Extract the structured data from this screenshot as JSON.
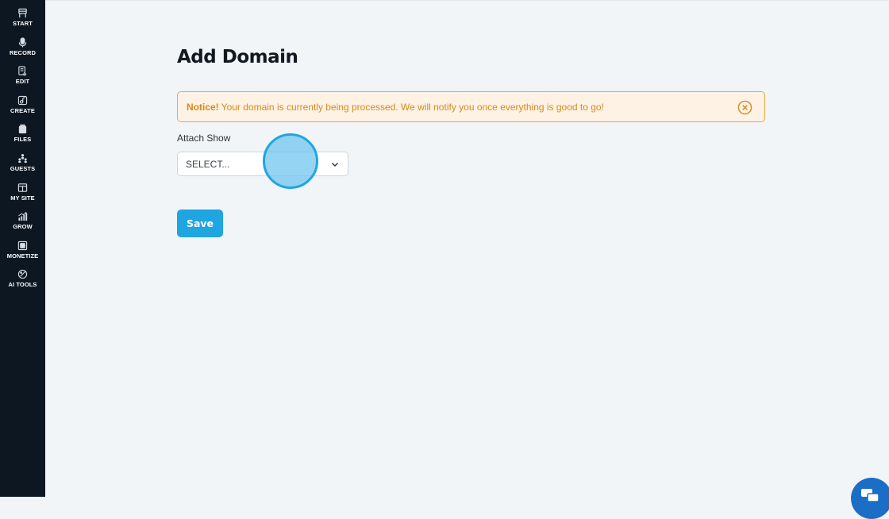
{
  "sidebar": {
    "items": [
      {
        "label": "START",
        "icon": "flag-icon"
      },
      {
        "label": "RECORD",
        "icon": "microphone-icon"
      },
      {
        "label": "EDIT",
        "icon": "edit-audio-icon"
      },
      {
        "label": "CREATE",
        "icon": "create-icon"
      },
      {
        "label": "FILES",
        "icon": "files-icon"
      },
      {
        "label": "GUESTS",
        "icon": "guests-icon"
      },
      {
        "label": "MY SITE",
        "icon": "website-icon"
      },
      {
        "label": "GROW",
        "icon": "growth-chart-icon"
      },
      {
        "label": "MONETIZE",
        "icon": "monetize-icon"
      },
      {
        "label": "AI TOOLS",
        "icon": "ai-tools-icon"
      }
    ]
  },
  "main": {
    "title": "Add Domain",
    "notice": {
      "label": "Notice!",
      "message": "Your domain is currently being processed. We will notify you once everything is good to go!"
    },
    "attach_show": {
      "label": "Attach Show",
      "placeholder": "SELECT..."
    },
    "save_label": "Save"
  },
  "colors": {
    "sidebar_bg": "#0c1722",
    "page_bg": "#f1f5f8",
    "accent": "#1fa6e0",
    "notice_text": "#d88a1e",
    "notice_border": "#f0a742",
    "notice_bg": "#fdf2e3",
    "chat_button": "#1b6ec6"
  }
}
